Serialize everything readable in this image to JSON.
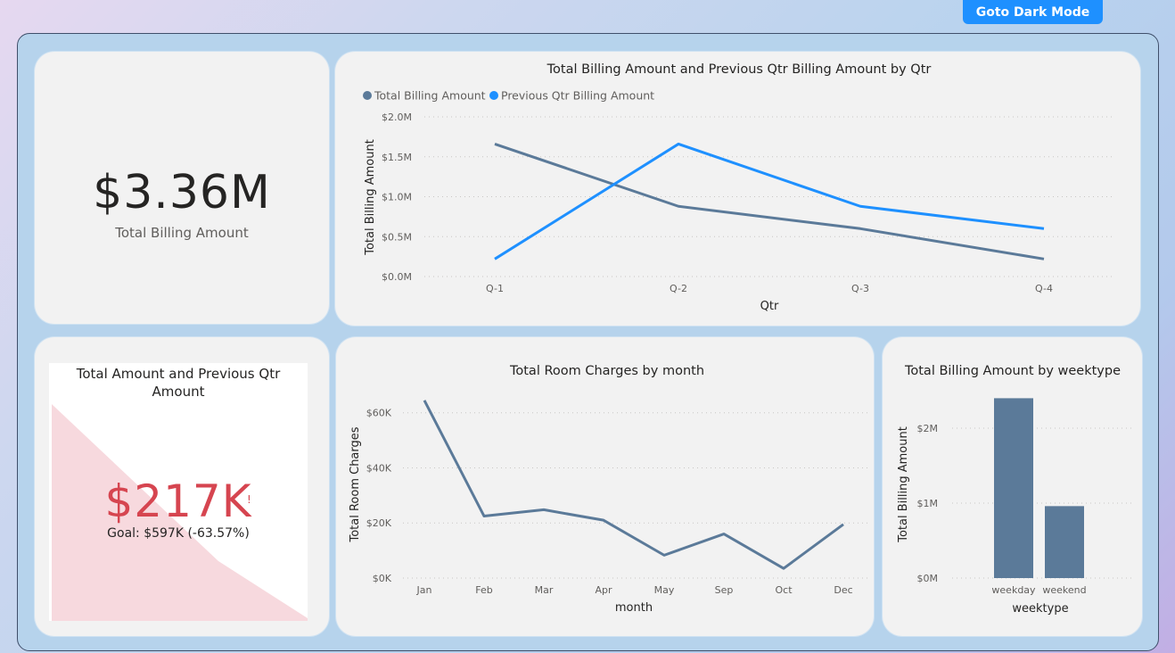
{
  "header": {
    "dark_mode_label": "Goto Dark Mode"
  },
  "kpi_total": {
    "value": "$3.36M",
    "label": "Total Billing Amount"
  },
  "kpi_goal": {
    "title": "Total Amount and Previous Qtr Amount",
    "value": "$217K",
    "alert": "!",
    "goal_text": "Goal: $597K (-63.57%)",
    "colors": {
      "value": "#d64550",
      "trend_fill": "#f7d9de"
    }
  },
  "charts": {
    "billing_by_qtr": {
      "title": "Total Billing Amount and Previous Qtr Billing Amount by Qtr",
      "legend": [
        "Total Billing Amount",
        "Previous Qtr Billing Amount"
      ]
    },
    "room_by_month": {
      "title": "Total Room Charges by month"
    },
    "billing_by_weektype": {
      "title": "Total Billing Amount by weektype"
    }
  },
  "chart_data": [
    {
      "type": "line",
      "title": "Total Billing Amount and Previous Qtr Billing Amount by Qtr",
      "xlabel": "Qtr",
      "ylabel": "Total Billing Amount",
      "categories": [
        "Q-1",
        "Q-2",
        "Q-3",
        "Q-4"
      ],
      "yticks": [
        "$0.0M",
        "$0.5M",
        "$1.0M",
        "$1.5M",
        "$2.0M"
      ],
      "ylim": [
        0,
        2.0
      ],
      "series": [
        {
          "name": "Total Billing Amount",
          "color": "#5b7a99",
          "values": [
            1.66,
            0.88,
            0.6,
            0.22
          ]
        },
        {
          "name": "Previous Qtr Billing Amount",
          "color": "#1e90ff",
          "values": [
            0.22,
            1.66,
            0.88,
            0.6
          ]
        }
      ],
      "legend": "top-left",
      "grid": true
    },
    {
      "type": "line",
      "title": "Total Room Charges by month",
      "xlabel": "month",
      "ylabel": "Total Room Charges",
      "categories": [
        "Jan",
        "Feb",
        "Mar",
        "Apr",
        "May",
        "Sep",
        "Oct",
        "Dec"
      ],
      "yticks": [
        "$0K",
        "$20K",
        "$40K",
        "$60K"
      ],
      "ylim": [
        0,
        68
      ],
      "series": [
        {
          "color": "#5b7a99",
          "values": [
            64.5,
            22.5,
            24.8,
            21.0,
            8.3,
            16.0,
            3.5,
            19.5
          ]
        }
      ],
      "grid": true
    },
    {
      "type": "bar",
      "title": "Total Billing Amount by weektype",
      "xlabel": "weektype",
      "ylabel": "Total Billing Amount",
      "categories": [
        "weekday",
        "weekend"
      ],
      "values": [
        2.4,
        0.96
      ],
      "yticks": [
        "$0M",
        "$1M",
        "$2M"
      ],
      "ylim": [
        0,
        2.5
      ],
      "color": "#5b7a99",
      "grid": true
    }
  ]
}
